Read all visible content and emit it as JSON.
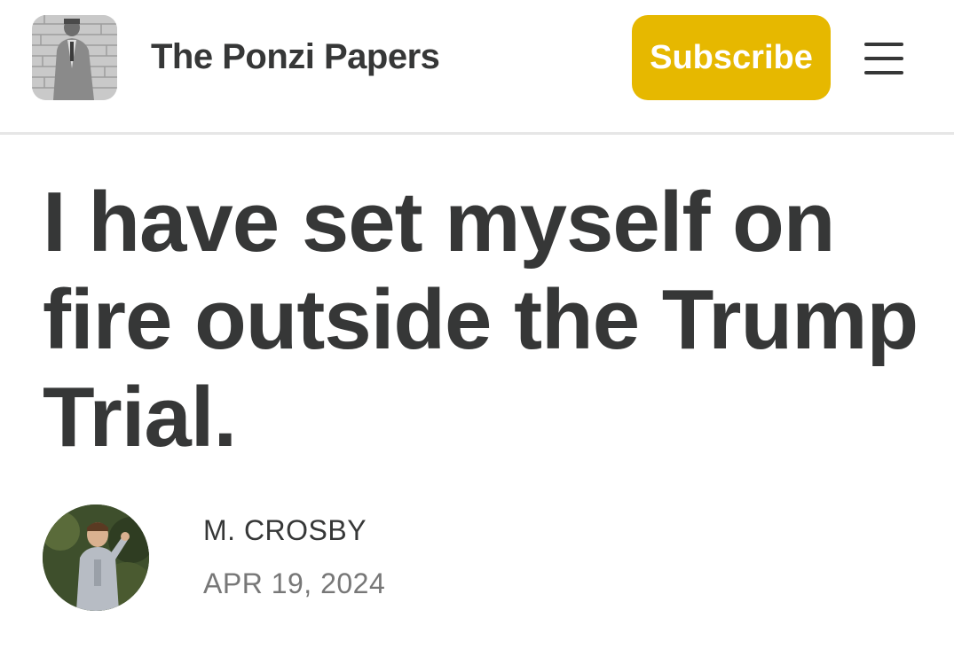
{
  "header": {
    "publication_name": "The Ponzi Papers",
    "subscribe_label": "Subscribe",
    "logo_icon": "publication-logo-photo",
    "menu_icon": "hamburger-menu-icon"
  },
  "post": {
    "title": "I have set myself on fire outside the Trump Trial.",
    "author": "M. CROSBY",
    "date": "APR 19, 2024",
    "avatar_icon": "author-avatar-photo"
  },
  "colors": {
    "accent": "#e6b800",
    "text": "#363737",
    "muted": "#777777",
    "divider": "#e6e6e6"
  }
}
